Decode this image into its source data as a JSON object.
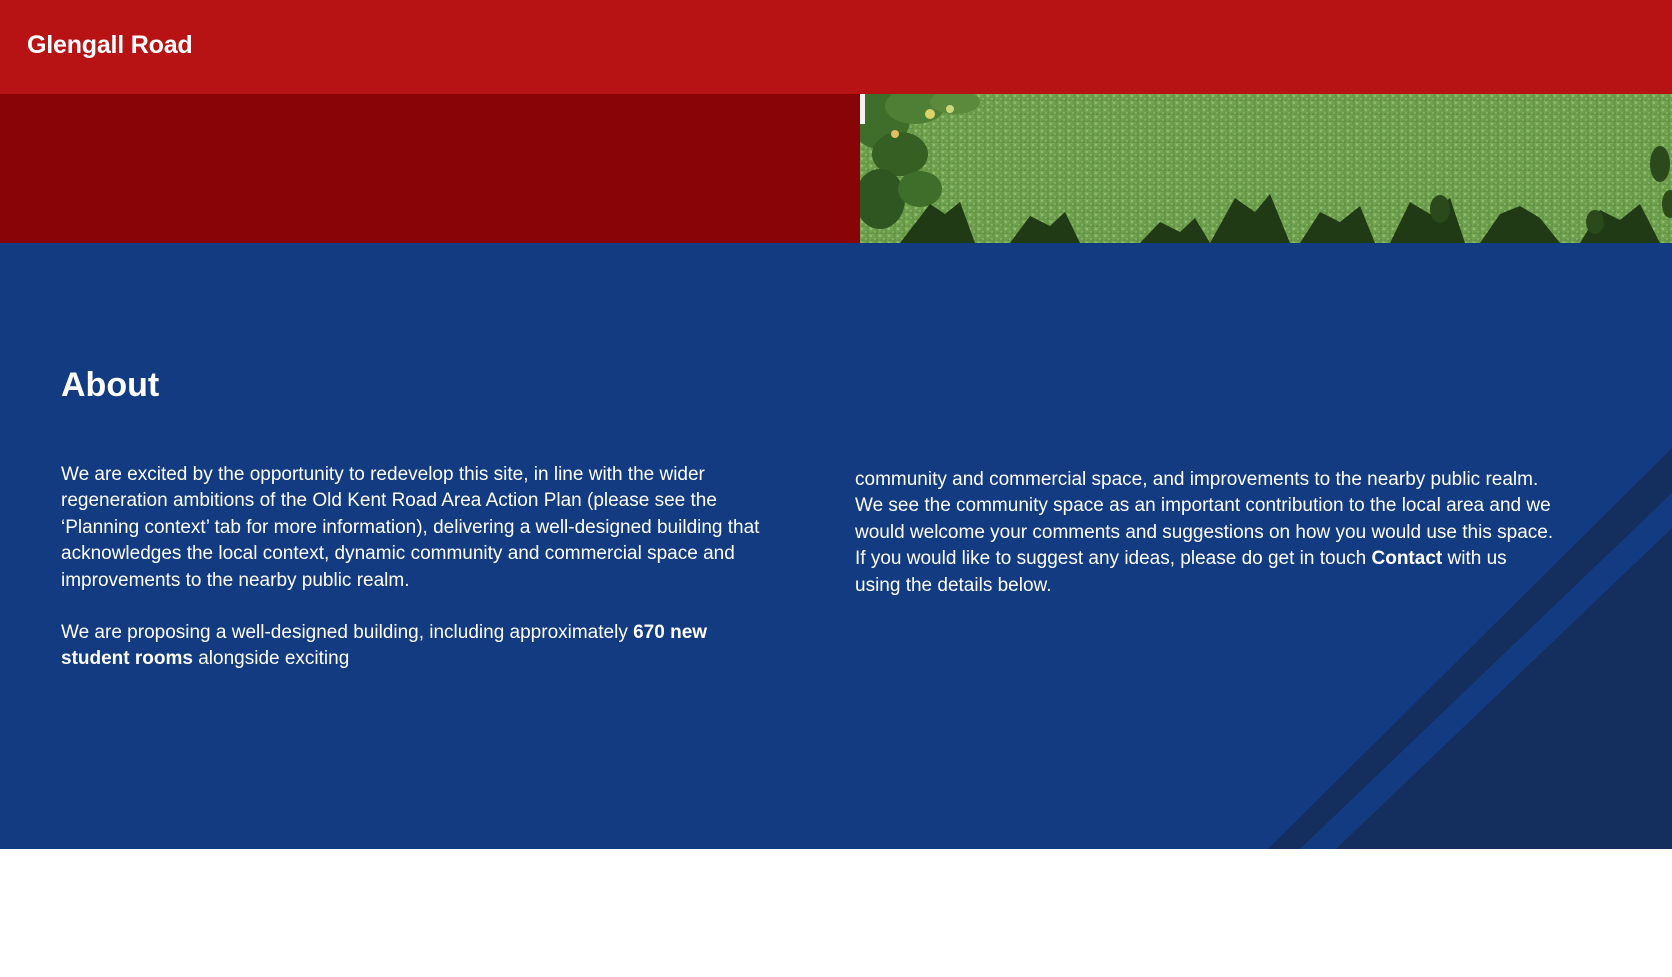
{
  "header": {
    "site_title": "Glengall Road"
  },
  "banner": {
    "image_icon": "garden-landscape-image"
  },
  "about": {
    "heading": "About",
    "left_column": {
      "paragraph_1": "We are excited by the opportunity to redevelop this site, in line with the wider regeneration ambitions of the Old Kent Road Area Action Plan (please see the ‘Planning context’ tab for more information), delivering a well-designed building that acknowledges the local context, dynamic community and commercial space and improvements to the nearby public realm.",
      "paragraph_2_before": "We are proposing a well-designed building, including approximately ",
      "paragraph_2_bold": "670 new student rooms",
      "paragraph_2_after": " alongside exciting"
    },
    "right_column": {
      "paragraph_before": "community and commercial space, and improvements to the nearby public realm. We see the community space as an important contribution to the local area and we would welcome your comments and suggestions on how you would use this space. If you would like to suggest any ideas, please do get in touch ",
      "contact_link": "Contact",
      "paragraph_after": " with us using the details below."
    }
  },
  "colors": {
    "header_red": "#b71315",
    "banner_dark_red": "#890406",
    "about_blue": "#133b82",
    "diagonal_dark_blue": "#142f5e"
  }
}
